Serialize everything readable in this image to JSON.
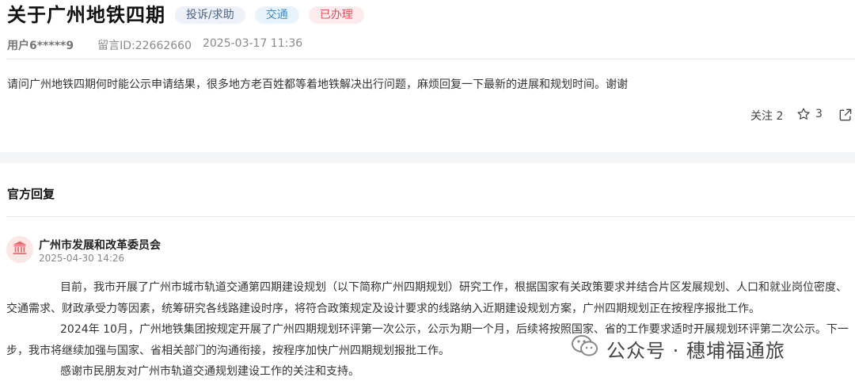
{
  "header": {
    "title": "关于广州地铁四期",
    "tags": [
      "投诉/求助",
      "交通",
      "已办理"
    ]
  },
  "meta": {
    "user": "用户6*****9",
    "message_id": "留言ID:22662660",
    "datetime": "2025-03-17 11:36"
  },
  "question": {
    "text": "请问广州地铁四期何时能公示申请结果，很多地方老百姓都等着地铁解决出行问题，麻烦回复一下最新的进展和规划时间。谢谢"
  },
  "actions": {
    "follow_label": "关注 2",
    "star_count": "3"
  },
  "official_reply": {
    "section_title": "官方回复",
    "department": "广州市发展和改革委员会",
    "datetime": "2025-04-30 14:26",
    "paragraphs": [
      "目前，我市开展了广州市城市轨道交通第四期建设规划（以下简称广州四期规划）研究工作，根据国家有关政策要求并结合片区发展规划、人口和就业岗位密度、交通需求、财政承受力等因素，统筹研究各线路建设时序，将符合政策规定及设计要求的线路纳入近期建设规划方案，广州四期规划正在按程序报批工作。",
      "2024年 10月，广州地铁集团按规定开展了广州四期规划环评第一次公示，公示为期一个月，后续将按照国家、省的工作要求适时开展规划环评第二次公示。下一步，我市将继续加强与国家、省相关部门的沟通衔接，按程序加快广州四期规划报批工作。",
      "感谢市民朋友对广州市轨道交通规划建设工作的关注和支持。"
    ]
  },
  "watermark": {
    "text": "公众号 · 穗埔福通旅"
  },
  "colors": {
    "tag_red": "#e0505c",
    "tag_teal": "#3f8fd0",
    "avatar_bg": "#fce7e7",
    "avatar_icon": "#e06a6a"
  }
}
